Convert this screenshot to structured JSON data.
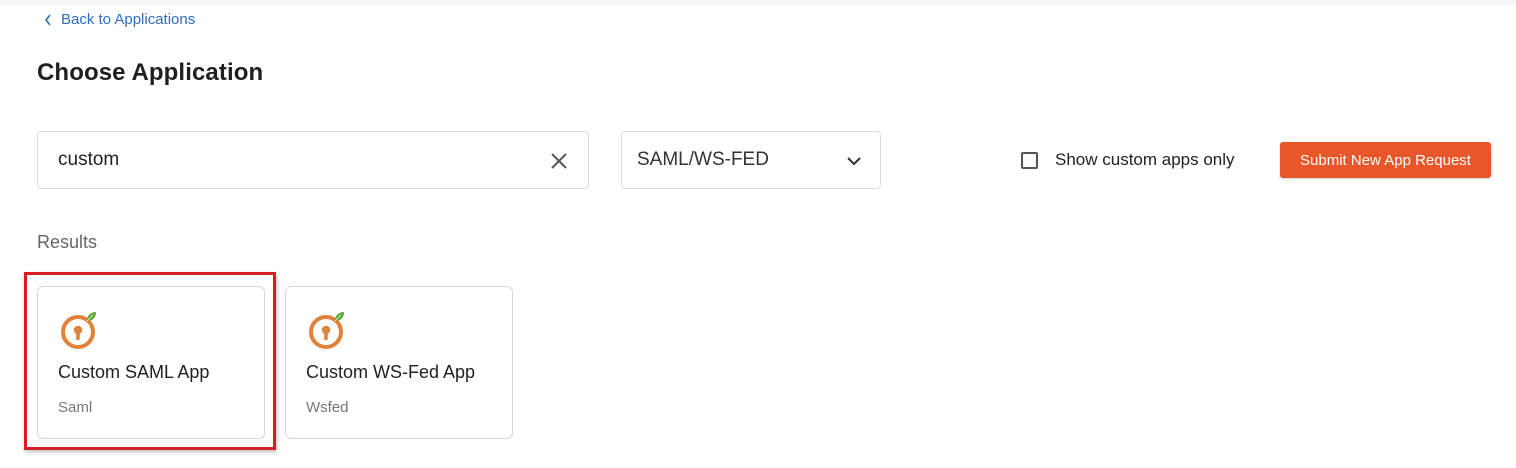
{
  "back_link": {
    "label": "Back to Applications",
    "icon": "chevron-left-icon"
  },
  "page_title": "Choose Application",
  "search": {
    "value": "custom",
    "placeholder": "",
    "clear_icon": "close-icon"
  },
  "protocol_filter": {
    "selected": "SAML/WS-FED",
    "icon": "chevron-down-icon"
  },
  "custom_only": {
    "label": "Show custom apps only",
    "checked": false
  },
  "submit_button": {
    "label": "Submit New App Request"
  },
  "results": {
    "heading": "Results",
    "apps": [
      {
        "name": "Custom SAML App",
        "protocol": "Saml",
        "icon": "app-logo-icon",
        "highlighted": true
      },
      {
        "name": "Custom WS-Fed App",
        "protocol": "Wsfed",
        "icon": "app-logo-icon",
        "highlighted": false
      }
    ]
  },
  "colors": {
    "link": "#2f6ebf",
    "accent": "#e8562a",
    "highlight": "#d42020",
    "logo_orange": "#e2823a",
    "logo_leaf": "#5aa531"
  }
}
